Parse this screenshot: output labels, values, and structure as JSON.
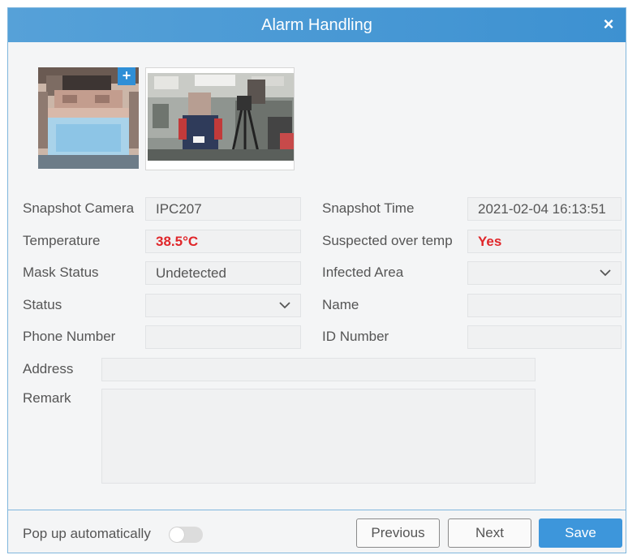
{
  "dialog": {
    "title": "Alarm Handling",
    "close_label": "×"
  },
  "snapshot": {
    "add_label": "+"
  },
  "fields": {
    "snapshot_camera": {
      "label": "Snapshot Camera",
      "value": "IPC207"
    },
    "snapshot_time": {
      "label": "Snapshot Time",
      "value": "2021-02-04 16:13:51"
    },
    "temperature": {
      "label": "Temperature",
      "value": "38.5°C"
    },
    "suspected_over_temp": {
      "label": "Suspected over temp",
      "value": "Yes"
    },
    "mask_status": {
      "label": "Mask Status",
      "value": "Undetected"
    },
    "infected_area": {
      "label": "Infected Area",
      "value": ""
    },
    "status": {
      "label": "Status",
      "value": ""
    },
    "name": {
      "label": "Name",
      "value": ""
    },
    "phone_number": {
      "label": "Phone Number",
      "value": ""
    },
    "id_number": {
      "label": "ID Number",
      "value": ""
    },
    "address": {
      "label": "Address",
      "value": ""
    },
    "remark": {
      "label": "Remark",
      "value": ""
    }
  },
  "footer": {
    "popup_label": "Pop up automatically",
    "popup_enabled": false,
    "previous_label": "Previous",
    "next_label": "Next",
    "save_label": "Save"
  },
  "colors": {
    "title_bar": "#4a9ad6",
    "accent": "#3d96db",
    "alert_red": "#e0262a"
  }
}
